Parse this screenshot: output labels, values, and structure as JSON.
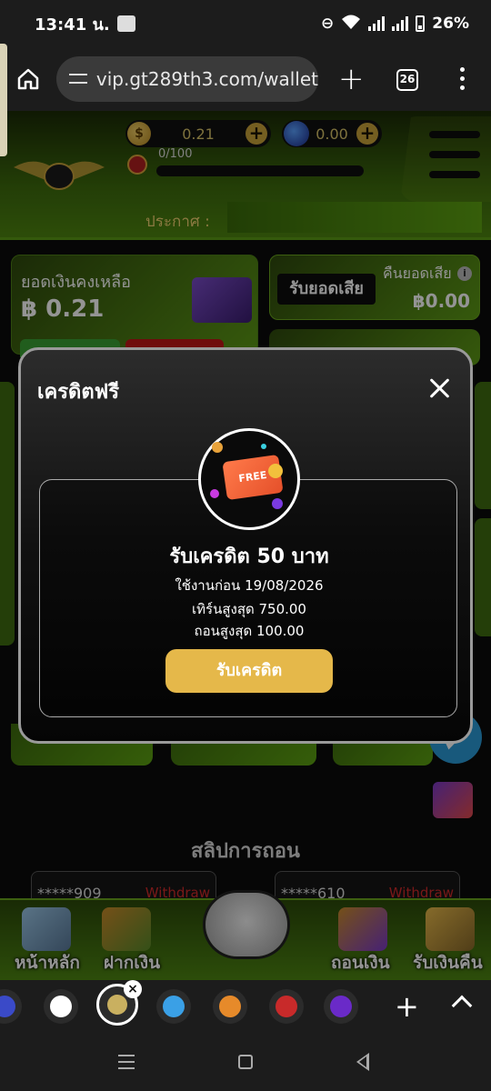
{
  "statusbar": {
    "time": "13:41 น.",
    "battery": "26%"
  },
  "browser": {
    "url": "vip.gt289th3.com/wallet",
    "tab_count": "26"
  },
  "header": {
    "coin_balance": "0.21",
    "gem_balance": "0.00",
    "xp": "0/100",
    "announce_label": "ประกาศ :"
  },
  "wallet": {
    "balance_label": "ยอดเงินคงเหลือ",
    "balance_value": "฿ 0.21",
    "refund_button": "รับยอดเสีย",
    "refund_label": "คืนยอดเสีย",
    "refund_value": "฿0.00"
  },
  "slips": {
    "title": "สลิปการถอน",
    "items": [
      {
        "account": "*****909",
        "type": "Withdraw"
      },
      {
        "account": "*****610",
        "type": "Withdraw"
      }
    ]
  },
  "site_nav": {
    "home": "หน้าหลัก",
    "deposit": "ฝากเงิน",
    "withdraw": "ถอนเงิน",
    "cashback": "รับเงินคืน"
  },
  "modal": {
    "title": "เครดิตฟรี",
    "badge_text": "FREE",
    "credit_title": "รับเครดิต 50 บาท",
    "expire": "ใช้งานก่อน 19/08/2026",
    "turnover": "เทิร์นสูงสุด 750.00",
    "max_withdraw": "ถอนสูงสุด 100.00",
    "claim_button": "รับเครดิต"
  },
  "colors": {
    "accent_green": "#5da212",
    "claim_gold": "#e5b84a",
    "withdraw_red": "#d02a2a"
  }
}
